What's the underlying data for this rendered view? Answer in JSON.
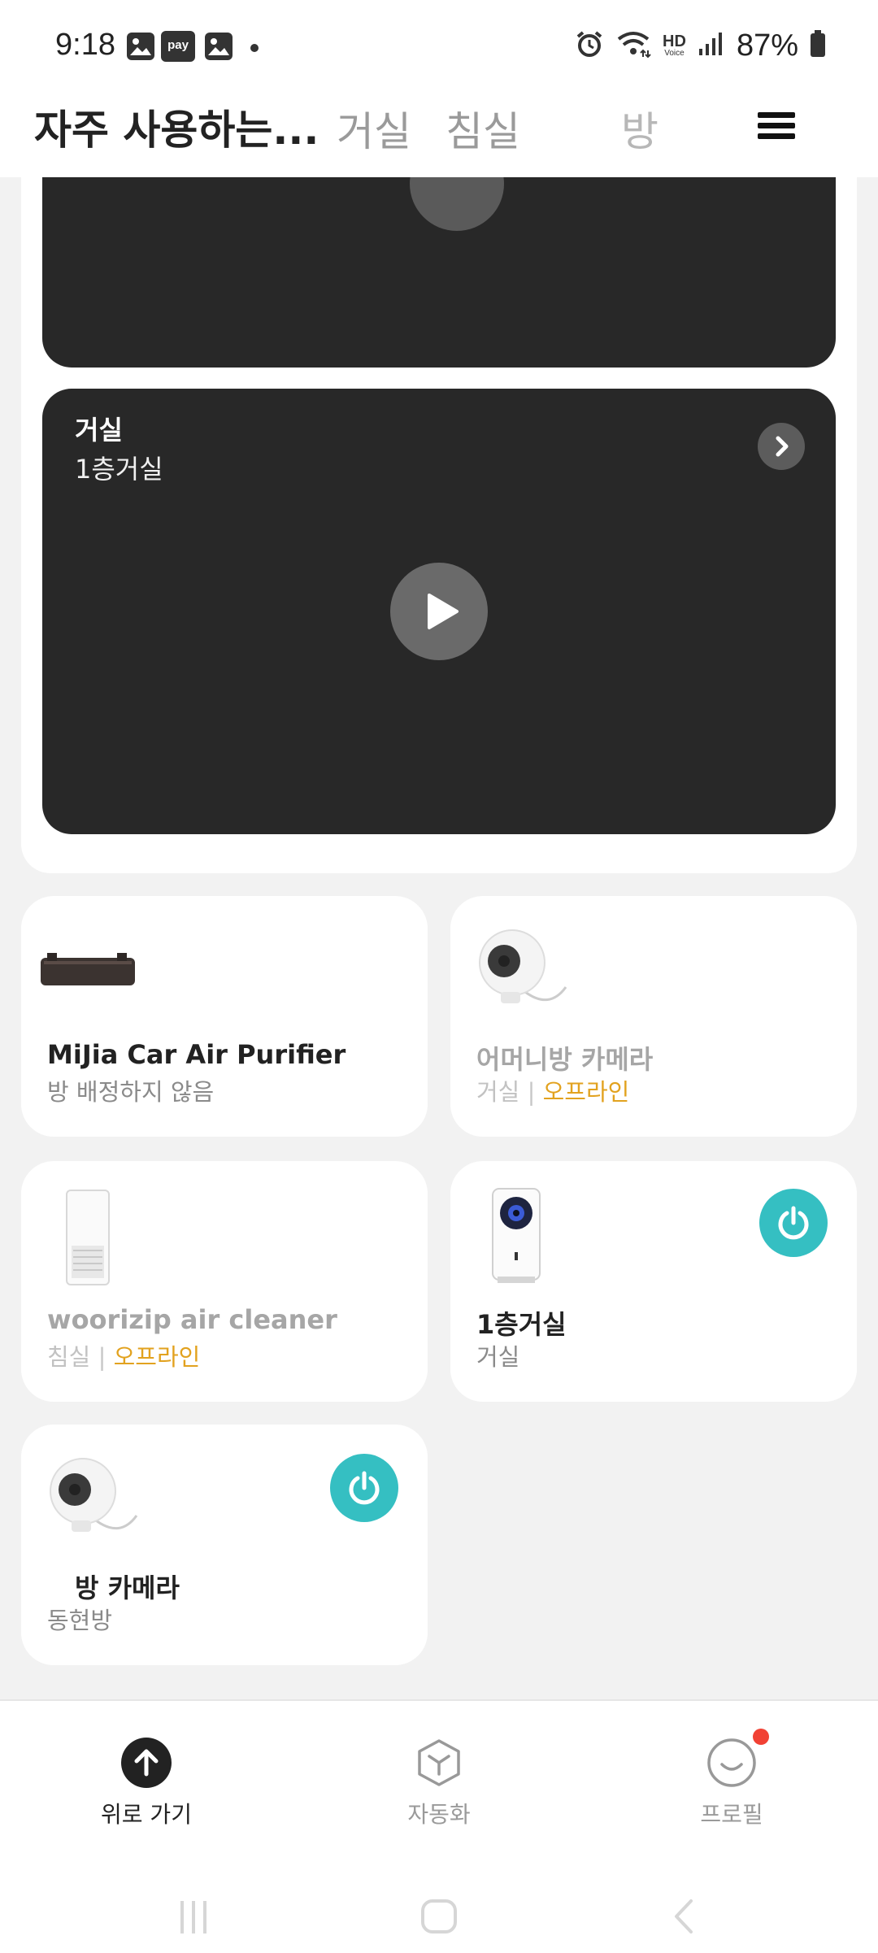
{
  "status_bar": {
    "time": "9:18",
    "pay_label": "pay",
    "hd_label": "HD",
    "voice_label": "Voice",
    "battery_text": "87%"
  },
  "header": {
    "active_tab": "자주 사용하는...",
    "tabs": [
      "거실",
      "침실"
    ],
    "faded_tab": "방",
    "menu_icon": "hamburger-menu-icon"
  },
  "cameras": {
    "main": {
      "title": "거실",
      "subtitle": "1층거실"
    }
  },
  "devices": [
    {
      "name": "MiJia Car Air Purifier",
      "room": "방 배정하지 않음",
      "status": "",
      "offline": false,
      "icon": "car-air-purifier-image"
    },
    {
      "name": "어머니방 카메라",
      "room": "거실",
      "status": "오프라인",
      "offline": true,
      "icon": "round-camera-image"
    },
    {
      "name": "woorizip air cleaner",
      "room": "침실",
      "status": "오프라인",
      "offline": true,
      "icon": "air-cleaner-image"
    },
    {
      "name": "1층거실",
      "room": "거실",
      "status": "",
      "offline": false,
      "icon": "box-camera-image"
    },
    {
      "name": "방 카메라",
      "room": "동현방",
      "status": "",
      "offline": false,
      "icon": "round-camera-image"
    }
  ],
  "bottom_nav": {
    "items": [
      {
        "label": "위로 가기",
        "icon": "arrow-up-icon",
        "active": true
      },
      {
        "label": "자동화",
        "icon": "automation-cube-icon",
        "active": false
      },
      {
        "label": "프로필",
        "icon": "profile-smile-icon",
        "active": false
      }
    ]
  },
  "colors": {
    "accent_power": "#35bfc2",
    "offline": "#e2a21f",
    "badge": "#f14134",
    "card_dark": "#282828"
  }
}
